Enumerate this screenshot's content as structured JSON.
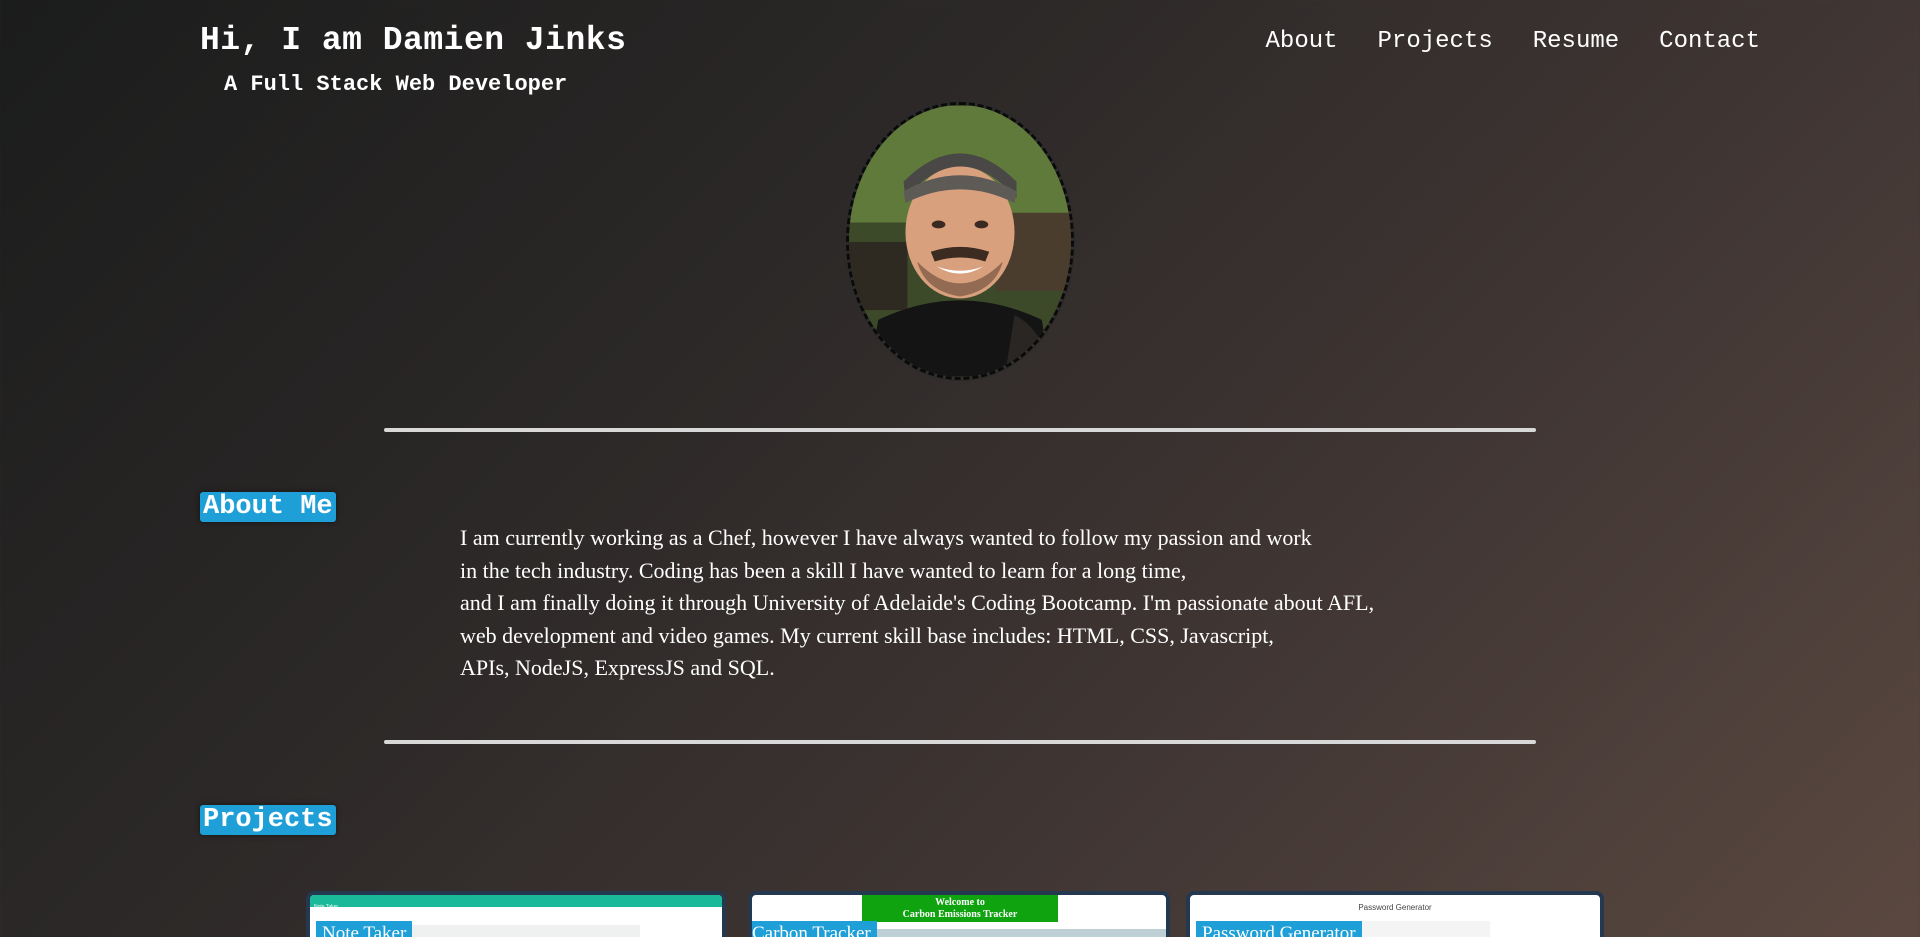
{
  "header": {
    "title": "Hi, I am Damien Jinks",
    "subtitle": "A Full Stack Web Developer"
  },
  "nav": {
    "items": [
      {
        "label": "About"
      },
      {
        "label": "Projects"
      },
      {
        "label": "Resume"
      },
      {
        "label": "Contact"
      }
    ]
  },
  "profile": {
    "photo_icon": "profile-photo"
  },
  "about": {
    "heading": "About Me",
    "lines": [
      "I am currently working as a Chef, however I have always wanted to follow my passion and work",
      "in the tech industry. Coding has been a skill I have wanted to learn for a long time,",
      "and I am finally doing it through University of Adelaide's Coding Bootcamp. I'm passionate about AFL,",
      "web development and video games. My current skill base includes: HTML, CSS, Javascript,",
      "APIs, NodeJS, ExpressJS and SQL."
    ]
  },
  "projects": {
    "heading": "Projects",
    "cards": [
      {
        "label": "Note Taker",
        "thumb_header": "Note Taker"
      },
      {
        "label": "Carbon Tracker",
        "thumb_banner_line1": "Welcome to",
        "thumb_banner_line2": "Carbon Emissions Tracker"
      },
      {
        "label": "Password Generator",
        "thumb_title": "Password Generator"
      }
    ]
  },
  "colors": {
    "accent": "#1e9fd8",
    "divider": "#d8d8d8",
    "card_border": "#24384f"
  }
}
